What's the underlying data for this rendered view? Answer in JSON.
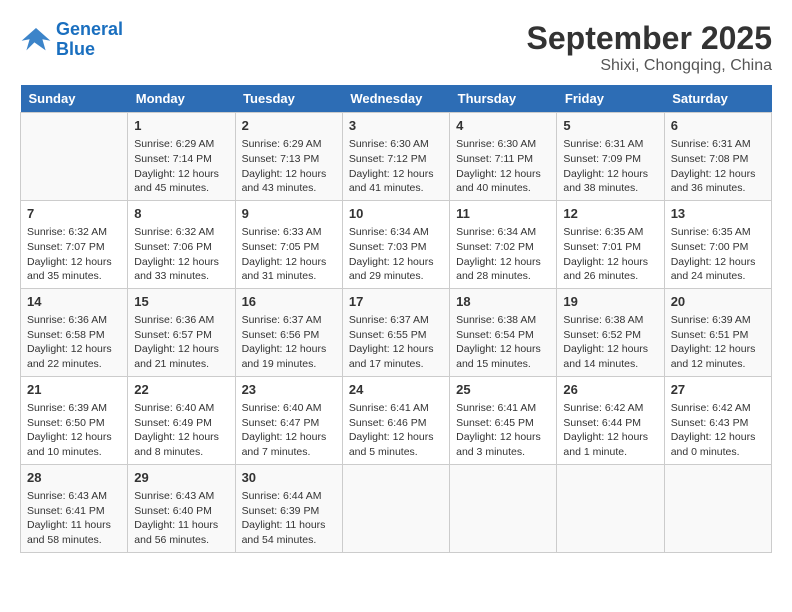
{
  "logo": {
    "line1": "General",
    "line2": "Blue"
  },
  "title": "September 2025",
  "subtitle": "Shixi, Chongqing, China",
  "weekdays": [
    "Sunday",
    "Monday",
    "Tuesday",
    "Wednesday",
    "Thursday",
    "Friday",
    "Saturday"
  ],
  "weeks": [
    [
      {
        "day": "",
        "sunrise": "",
        "sunset": "",
        "daylight": ""
      },
      {
        "day": "1",
        "sunrise": "Sunrise: 6:29 AM",
        "sunset": "Sunset: 7:14 PM",
        "daylight": "Daylight: 12 hours and 45 minutes."
      },
      {
        "day": "2",
        "sunrise": "Sunrise: 6:29 AM",
        "sunset": "Sunset: 7:13 PM",
        "daylight": "Daylight: 12 hours and 43 minutes."
      },
      {
        "day": "3",
        "sunrise": "Sunrise: 6:30 AM",
        "sunset": "Sunset: 7:12 PM",
        "daylight": "Daylight: 12 hours and 41 minutes."
      },
      {
        "day": "4",
        "sunrise": "Sunrise: 6:30 AM",
        "sunset": "Sunset: 7:11 PM",
        "daylight": "Daylight: 12 hours and 40 minutes."
      },
      {
        "day": "5",
        "sunrise": "Sunrise: 6:31 AM",
        "sunset": "Sunset: 7:09 PM",
        "daylight": "Daylight: 12 hours and 38 minutes."
      },
      {
        "day": "6",
        "sunrise": "Sunrise: 6:31 AM",
        "sunset": "Sunset: 7:08 PM",
        "daylight": "Daylight: 12 hours and 36 minutes."
      }
    ],
    [
      {
        "day": "7",
        "sunrise": "Sunrise: 6:32 AM",
        "sunset": "Sunset: 7:07 PM",
        "daylight": "Daylight: 12 hours and 35 minutes."
      },
      {
        "day": "8",
        "sunrise": "Sunrise: 6:32 AM",
        "sunset": "Sunset: 7:06 PM",
        "daylight": "Daylight: 12 hours and 33 minutes."
      },
      {
        "day": "9",
        "sunrise": "Sunrise: 6:33 AM",
        "sunset": "Sunset: 7:05 PM",
        "daylight": "Daylight: 12 hours and 31 minutes."
      },
      {
        "day": "10",
        "sunrise": "Sunrise: 6:34 AM",
        "sunset": "Sunset: 7:03 PM",
        "daylight": "Daylight: 12 hours and 29 minutes."
      },
      {
        "day": "11",
        "sunrise": "Sunrise: 6:34 AM",
        "sunset": "Sunset: 7:02 PM",
        "daylight": "Daylight: 12 hours and 28 minutes."
      },
      {
        "day": "12",
        "sunrise": "Sunrise: 6:35 AM",
        "sunset": "Sunset: 7:01 PM",
        "daylight": "Daylight: 12 hours and 26 minutes."
      },
      {
        "day": "13",
        "sunrise": "Sunrise: 6:35 AM",
        "sunset": "Sunset: 7:00 PM",
        "daylight": "Daylight: 12 hours and 24 minutes."
      }
    ],
    [
      {
        "day": "14",
        "sunrise": "Sunrise: 6:36 AM",
        "sunset": "Sunset: 6:58 PM",
        "daylight": "Daylight: 12 hours and 22 minutes."
      },
      {
        "day": "15",
        "sunrise": "Sunrise: 6:36 AM",
        "sunset": "Sunset: 6:57 PM",
        "daylight": "Daylight: 12 hours and 21 minutes."
      },
      {
        "day": "16",
        "sunrise": "Sunrise: 6:37 AM",
        "sunset": "Sunset: 6:56 PM",
        "daylight": "Daylight: 12 hours and 19 minutes."
      },
      {
        "day": "17",
        "sunrise": "Sunrise: 6:37 AM",
        "sunset": "Sunset: 6:55 PM",
        "daylight": "Daylight: 12 hours and 17 minutes."
      },
      {
        "day": "18",
        "sunrise": "Sunrise: 6:38 AM",
        "sunset": "Sunset: 6:54 PM",
        "daylight": "Daylight: 12 hours and 15 minutes."
      },
      {
        "day": "19",
        "sunrise": "Sunrise: 6:38 AM",
        "sunset": "Sunset: 6:52 PM",
        "daylight": "Daylight: 12 hours and 14 minutes."
      },
      {
        "day": "20",
        "sunrise": "Sunrise: 6:39 AM",
        "sunset": "Sunset: 6:51 PM",
        "daylight": "Daylight: 12 hours and 12 minutes."
      }
    ],
    [
      {
        "day": "21",
        "sunrise": "Sunrise: 6:39 AM",
        "sunset": "Sunset: 6:50 PM",
        "daylight": "Daylight: 12 hours and 10 minutes."
      },
      {
        "day": "22",
        "sunrise": "Sunrise: 6:40 AM",
        "sunset": "Sunset: 6:49 PM",
        "daylight": "Daylight: 12 hours and 8 minutes."
      },
      {
        "day": "23",
        "sunrise": "Sunrise: 6:40 AM",
        "sunset": "Sunset: 6:47 PM",
        "daylight": "Daylight: 12 hours and 7 minutes."
      },
      {
        "day": "24",
        "sunrise": "Sunrise: 6:41 AM",
        "sunset": "Sunset: 6:46 PM",
        "daylight": "Daylight: 12 hours and 5 minutes."
      },
      {
        "day": "25",
        "sunrise": "Sunrise: 6:41 AM",
        "sunset": "Sunset: 6:45 PM",
        "daylight": "Daylight: 12 hours and 3 minutes."
      },
      {
        "day": "26",
        "sunrise": "Sunrise: 6:42 AM",
        "sunset": "Sunset: 6:44 PM",
        "daylight": "Daylight: 12 hours and 1 minute."
      },
      {
        "day": "27",
        "sunrise": "Sunrise: 6:42 AM",
        "sunset": "Sunset: 6:43 PM",
        "daylight": "Daylight: 12 hours and 0 minutes."
      }
    ],
    [
      {
        "day": "28",
        "sunrise": "Sunrise: 6:43 AM",
        "sunset": "Sunset: 6:41 PM",
        "daylight": "Daylight: 11 hours and 58 minutes."
      },
      {
        "day": "29",
        "sunrise": "Sunrise: 6:43 AM",
        "sunset": "Sunset: 6:40 PM",
        "daylight": "Daylight: 11 hours and 56 minutes."
      },
      {
        "day": "30",
        "sunrise": "Sunrise: 6:44 AM",
        "sunset": "Sunset: 6:39 PM",
        "daylight": "Daylight: 11 hours and 54 minutes."
      },
      {
        "day": "",
        "sunrise": "",
        "sunset": "",
        "daylight": ""
      },
      {
        "day": "",
        "sunrise": "",
        "sunset": "",
        "daylight": ""
      },
      {
        "day": "",
        "sunrise": "",
        "sunset": "",
        "daylight": ""
      },
      {
        "day": "",
        "sunrise": "",
        "sunset": "",
        "daylight": ""
      }
    ]
  ]
}
